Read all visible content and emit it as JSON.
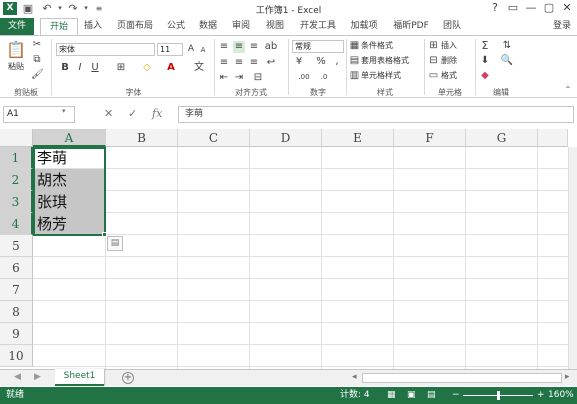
{
  "window": {
    "title": "工作簿1 - Excel",
    "help": "?",
    "controls": [
      "▭",
      "—",
      "▢",
      "✕"
    ]
  },
  "quick_access": {
    "icons": [
      "save-icon",
      "undo-icon",
      "redo-icon",
      "customize-icon"
    ]
  },
  "ribbon_tabs": {
    "file": "文件",
    "tabs": [
      "开始",
      "插入",
      "页面布局",
      "公式",
      "数据",
      "审阅",
      "视图",
      "开发工具",
      "加载项",
      "福昕PDF",
      "团队"
    ],
    "active": "开始",
    "login": "登录"
  },
  "ribbon": {
    "paste_label": "粘贴",
    "font_name": "宋体",
    "font_size": "11",
    "bold": "B",
    "italic": "I",
    "underline": "U",
    "number_format": "常规",
    "conditional_format": "条件格式",
    "table_format": "套用表格格式",
    "cell_style": "单元格样式",
    "insert": "插入",
    "delete": "删除",
    "format": "格式",
    "groups": [
      "剪贴板",
      "字体",
      "对齐方式",
      "数字",
      "样式",
      "单元格",
      "编辑"
    ]
  },
  "formula_bar": {
    "name_box": "A1",
    "cancel": "✕",
    "enter": "✓",
    "fx": "fx",
    "content": "李萌"
  },
  "grid": {
    "columns": [
      "A",
      "B",
      "C",
      "D",
      "E",
      "F",
      "G"
    ],
    "selected_column": "A",
    "rows": [
      "1",
      "2",
      "3",
      "4",
      "5",
      "6",
      "7",
      "8",
      "9",
      "10"
    ],
    "cells": [
      "李萌",
      "胡杰",
      "张琪",
      "杨芳"
    ]
  },
  "sheets": {
    "tabs": [
      "Sheet1"
    ],
    "add": "+"
  },
  "status": {
    "ready": "就绪",
    "count": "计数: 4",
    "zoom": "160%",
    "zoom_minus": "−",
    "zoom_plus": "+"
  },
  "colors": {
    "accent": "#217346",
    "selection_fill": "#c6c6c6"
  }
}
